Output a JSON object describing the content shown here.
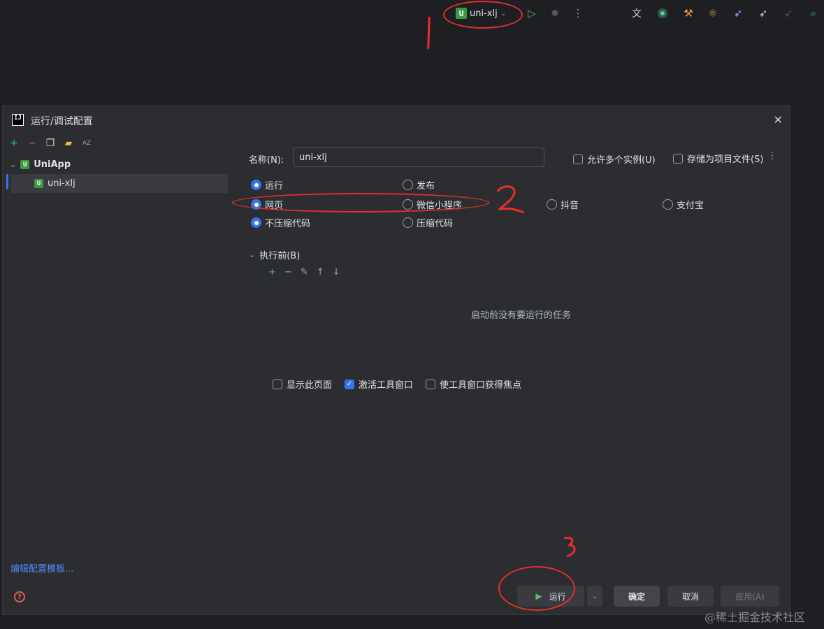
{
  "toolbar": {
    "run_config_label": "uni-xlj",
    "run_config_badge": "U"
  },
  "annotations": {
    "mark1": "1",
    "mark2": "2",
    "mark3": "3",
    "color": "#e62e2e"
  },
  "dialog": {
    "title": "运行/调试配置",
    "logo_text": "IJ",
    "close_icon": "close-icon"
  },
  "tree": {
    "toolbar_icons": [
      "add-icon",
      "remove-icon",
      "copy-icon",
      "folder-icon",
      "sort-alpha-icon"
    ],
    "sort_label": "AZ",
    "group_label": "UniApp",
    "child_label": "uni-xlj",
    "badge": "U"
  },
  "form": {
    "name_label": "名称(N):",
    "name_value": "uni-xlj",
    "allow_multiple": {
      "label": "允许多个实例(U)",
      "checked": false
    },
    "store_as_file": {
      "label": "存储为项目文件(S)",
      "checked": false
    },
    "radios_row1": [
      {
        "label": "运行",
        "selected": true
      },
      {
        "label": "发布",
        "selected": false
      }
    ],
    "radios_row2": [
      {
        "label": "网页",
        "selected": true
      },
      {
        "label": "微信小程序",
        "selected": false
      },
      {
        "label": "抖音",
        "selected": false
      },
      {
        "label": "支付宝",
        "selected": false
      }
    ],
    "radios_row3": [
      {
        "label": "不压缩代码",
        "selected": true
      },
      {
        "label": "压缩代码",
        "selected": false
      }
    ],
    "before_launch_label": "执行前(B)",
    "empty_tasks": "启动前没有要运行的任务",
    "show_page": {
      "label": "显示此页面",
      "checked": false
    },
    "activate_tool_window": {
      "label": "激活工具窗口",
      "checked": true
    },
    "focus_tool_window": {
      "label": "使工具窗口获得焦点",
      "checked": false
    }
  },
  "footer": {
    "edit_templates": "编辑配置模板...",
    "run": "运行",
    "ok": "确定",
    "cancel": "取消",
    "apply": "应用(A)"
  },
  "watermark": "@稀土掘金技术社区",
  "colors": {
    "accent": "#3574f0",
    "badge_green": "#3c9a45",
    "background": "#1e1f22",
    "dialog_bg": "#2b2d30"
  }
}
